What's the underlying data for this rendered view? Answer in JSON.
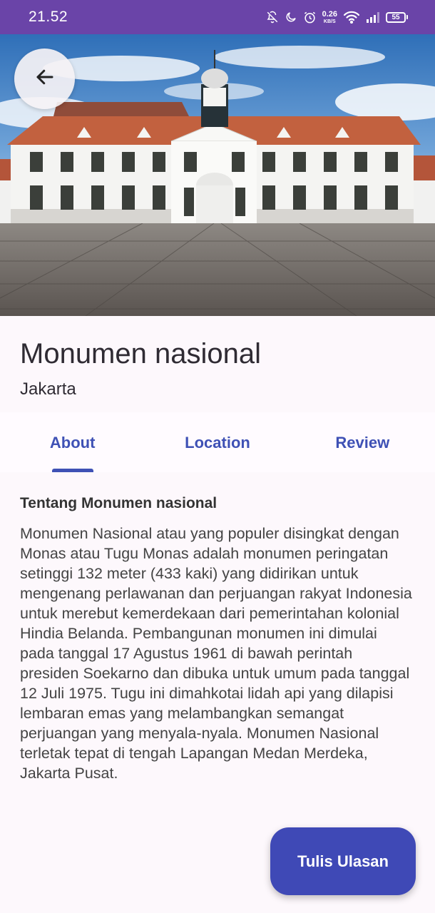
{
  "status_bar": {
    "time": "21.52",
    "net_speed_value": "0.26",
    "net_speed_unit": "KB/S",
    "battery_level": "55",
    "icons": [
      "bell-off-icon",
      "moon-icon",
      "alarm-icon",
      "wifi-icon",
      "signal-icon",
      "battery-icon"
    ]
  },
  "header": {
    "back_icon": "arrow-left-icon"
  },
  "place": {
    "title": "Monumen nasional",
    "city": "Jakarta"
  },
  "tabs": [
    {
      "label": "About",
      "selected": true
    },
    {
      "label": "Location",
      "selected": false
    },
    {
      "label": "Review",
      "selected": false
    }
  ],
  "about": {
    "heading": "Tentang Monumen nasional",
    "body": "Monumen Nasional atau yang populer disingkat dengan Monas atau Tugu Monas adalah monumen peringatan setinggi 132 meter (433 kaki) yang didirikan untuk mengenang perlawanan dan perjuangan rakyat Indonesia untuk merebut kemerdekaan dari pemerintahan kolonial Hindia Belanda. Pembangunan monumen ini dimulai pada tanggal 17 Agustus 1961 di bawah perintah presiden Soekarno dan dibuka untuk umum pada tanggal 12 Juli 1975. Tugu ini dimahkotai lidah api yang dilapisi lembaran emas yang melambangkan semangat perjuangan yang menyala-nyala. Monumen Nasional terletak tepat di tengah Lapangan Medan Merdeka, Jakarta Pusat."
  },
  "fab": {
    "label": "Tulis Ulasan"
  },
  "colors": {
    "status_bar": "#6a44a8",
    "accent": "#3f51b5",
    "fab": "#3f49b6",
    "background": "#fdf8fc"
  }
}
